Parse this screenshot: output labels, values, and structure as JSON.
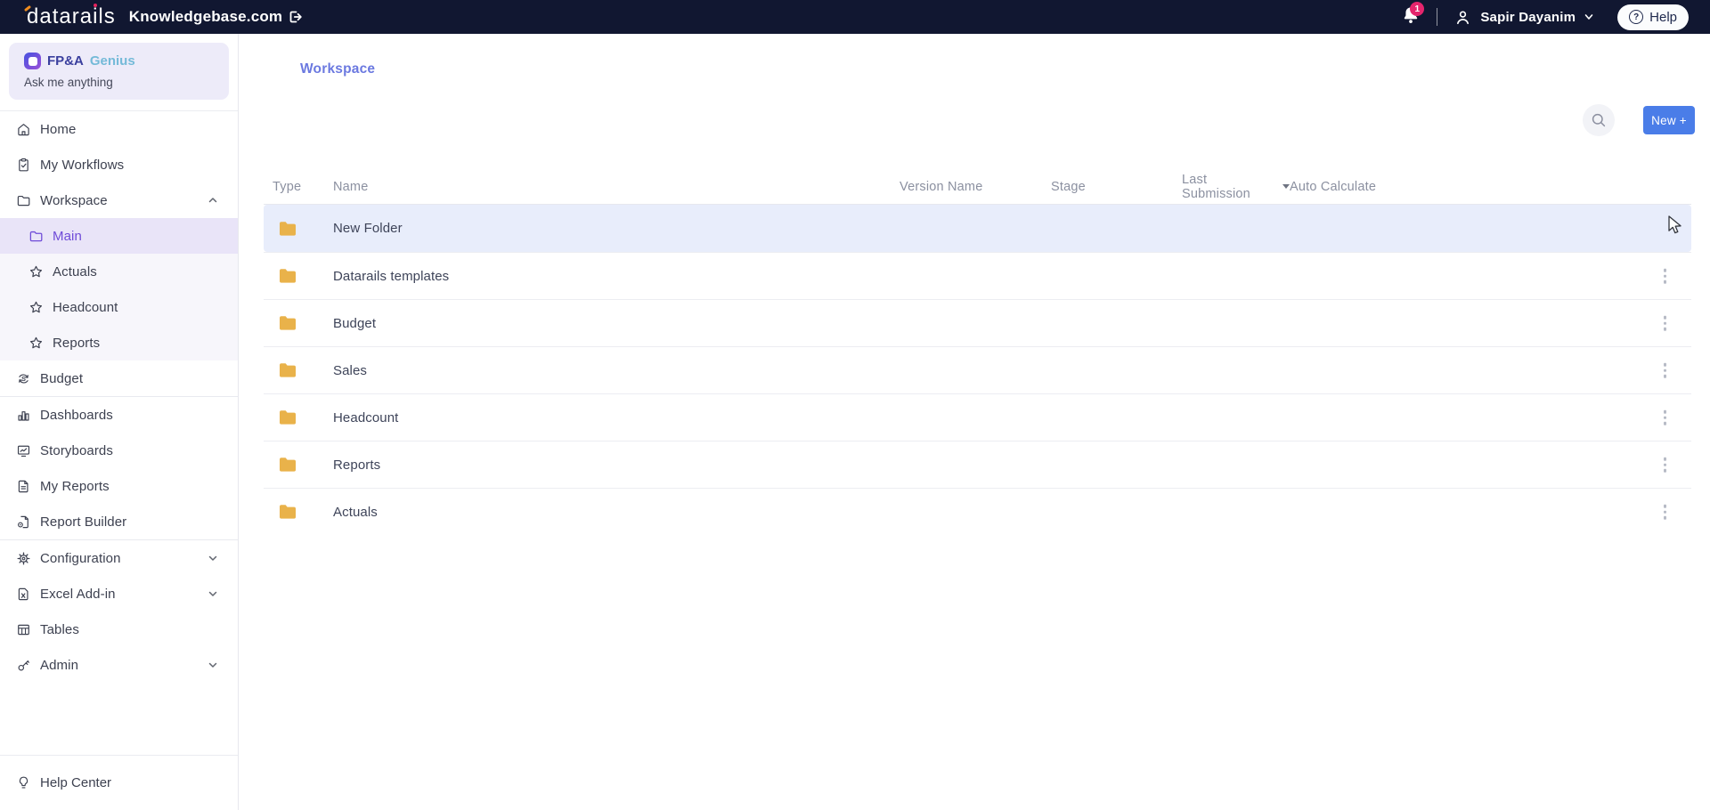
{
  "topbar": {
    "logo": "datara",
    "logo_i": "i",
    "logo_end": "ls",
    "knowledgebase_label": "Knowledgebase.com",
    "notification_count": "1",
    "user_name": "Sapir Dayanim",
    "help_label": "Help"
  },
  "sidebar": {
    "genius": {
      "title": "FP&A",
      "title_accent": "Genius",
      "subtitle": "Ask me anything"
    },
    "items": [
      {
        "label": "Home"
      },
      {
        "label": "My Workflows"
      },
      {
        "label": "Workspace",
        "expanded": true
      },
      {
        "label": "Main",
        "selected": true
      },
      {
        "label": "Actuals"
      },
      {
        "label": "Headcount"
      },
      {
        "label": "Reports"
      },
      {
        "label": "Budget"
      },
      {
        "label": "Dashboards"
      },
      {
        "label": "Storyboards"
      },
      {
        "label": "My Reports"
      },
      {
        "label": "Report Builder"
      },
      {
        "label": "Configuration",
        "collapsible": true
      },
      {
        "label": "Excel Add-in",
        "collapsible": true
      },
      {
        "label": "Tables"
      },
      {
        "label": "Admin",
        "collapsible": true
      }
    ],
    "help_center_label": "Help Center"
  },
  "main": {
    "breadcrumb": "Workspace",
    "new_button_label": "New +",
    "table": {
      "columns": [
        "Type",
        "Name",
        "Version Name",
        "Stage",
        "Last Submission",
        "Auto Calculate"
      ],
      "rows": [
        {
          "name": "New Folder",
          "selected": true
        },
        {
          "name": "Datarails templates"
        },
        {
          "name": "Budget"
        },
        {
          "name": "Sales"
        },
        {
          "name": "Headcount"
        },
        {
          "name": "Reports"
        },
        {
          "name": "Actuals"
        }
      ]
    }
  },
  "colors": {
    "topbar_bg": "#111731",
    "accent_blue": "#4a7de8",
    "badge_pink": "#e5256d",
    "selected_purple": "#6f4bd8",
    "row_highlight": "#e8edfb",
    "folder_amber": "#e9b24a",
    "breadcrumb_blue": "#6b79e0"
  }
}
